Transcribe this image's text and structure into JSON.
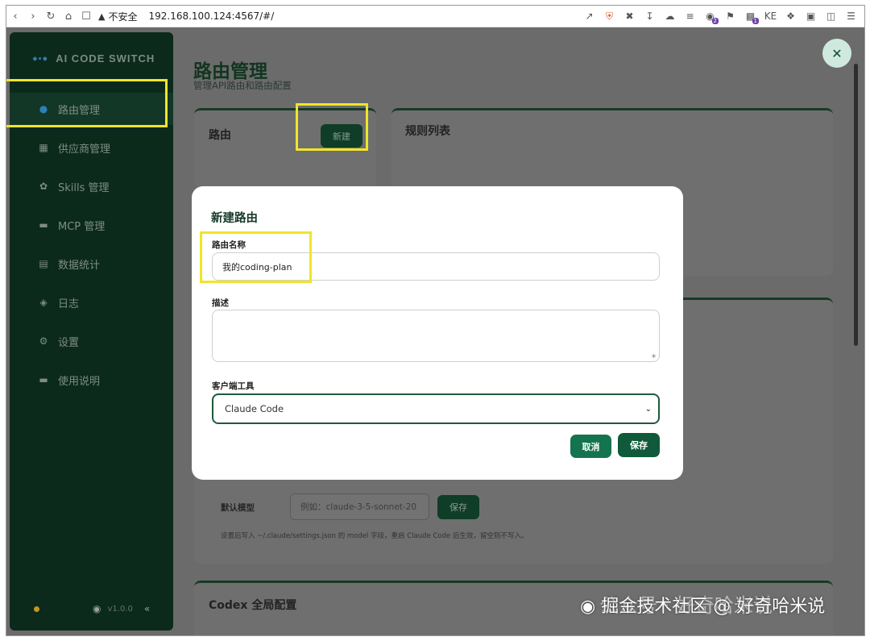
{
  "browser": {
    "insecure_label": "不安全",
    "url": "192.168.100.124:4567/#/",
    "ext_badge_1": "2",
    "ext_badge_2": "1",
    "ext_ke": "KE"
  },
  "sidebar": {
    "brand": "AI CODE SWITCH",
    "items": [
      {
        "label": "路由管理",
        "icon": "globe-icon"
      },
      {
        "label": "供应商管理",
        "icon": "building-icon"
      },
      {
        "label": "Skills 管理",
        "icon": "puzzle-icon"
      },
      {
        "label": "MCP 管理",
        "icon": "plug-icon"
      },
      {
        "label": "数据统计",
        "icon": "bar-chart-icon"
      },
      {
        "label": "日志",
        "icon": "log-icon"
      },
      {
        "label": "设置",
        "icon": "gear-icon"
      },
      {
        "label": "使用说明",
        "icon": "book-icon"
      }
    ],
    "version": "v1.0.0"
  },
  "main": {
    "title": "路由管理",
    "subtitle": "管理API路由和路由配置",
    "routes_card_title": "路由",
    "new_button": "新建",
    "rules_card_title": "规则列表",
    "default_model_label": "默认模型",
    "default_model_placeholder": "例如：claude-3-5-sonnet-20",
    "default_model_save": "保存",
    "default_model_hint": "设置后写入 ~/.claude/settings.json 的 model 字段，重启 Claude Code 后生效，留空则不写入。",
    "codex_card_title": "Codex 全局配置"
  },
  "modal": {
    "title": "新建路由",
    "name_label": "路由名称",
    "name_value": "我的coding-plan",
    "desc_label": "描述",
    "desc_value": "",
    "client_label": "客户端工具",
    "client_value": "Claude Code",
    "cancel": "取消",
    "save": "保存"
  },
  "watermark": {
    "text": "掘金技术社区 @ 好奇哈米说",
    "faint": "公众号 · 好奇哈米说"
  },
  "colors": {
    "sidebar_bg": "#0b2a1b",
    "primary": "#0f5a3a",
    "highlight": "#f0e52a"
  }
}
